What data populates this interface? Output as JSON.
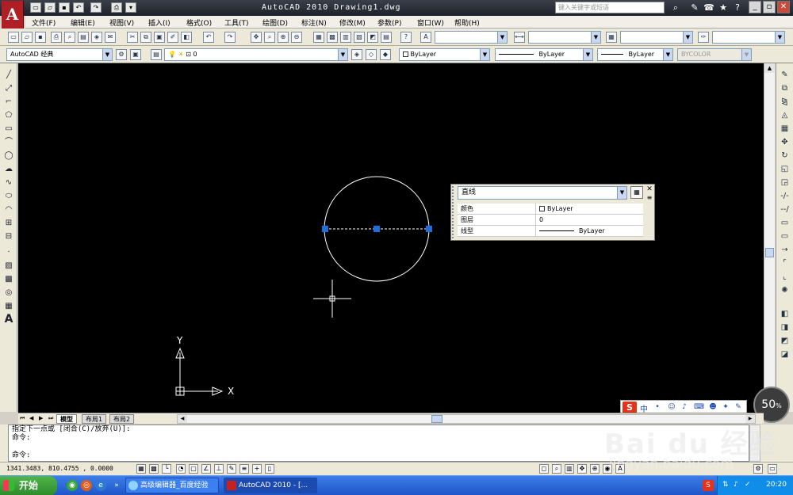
{
  "window": {
    "title": "AutoCAD 2010  Drawing1.dwg",
    "search_placeholder": "键入关键字或短语",
    "logo_letter": "A"
  },
  "menu": [
    {
      "label": "文件(F)"
    },
    {
      "label": "编辑(E)"
    },
    {
      "label": "视图(V)"
    },
    {
      "label": "插入(I)"
    },
    {
      "label": "格式(O)"
    },
    {
      "label": "工具(T)"
    },
    {
      "label": "绘图(D)"
    },
    {
      "label": "标注(N)"
    },
    {
      "label": "修改(M)"
    },
    {
      "label": "参数(P)"
    },
    {
      "label": "窗口(W)"
    },
    {
      "label": "帮助(H)"
    }
  ],
  "toolbar2": {
    "workspace": "AutoCAD 经典",
    "layer": "0",
    "color": "ByLayer",
    "linetype": "ByLayer",
    "lineweight": "ByLayer",
    "plotstyle": "BYCOLOR"
  },
  "properties_panel": {
    "object_type": "直线",
    "rows": [
      {
        "key": "颜色",
        "value": "ByLayer"
      },
      {
        "key": "图层",
        "value": "0"
      },
      {
        "key": "线型",
        "value": "ByLayer"
      }
    ]
  },
  "ucs": {
    "x_label": "X",
    "y_label": "Y"
  },
  "tabs": [
    {
      "label": "模型",
      "active": true
    },
    {
      "label": "布局1",
      "active": false
    },
    {
      "label": "布局2",
      "active": false
    }
  ],
  "command": {
    "lines": [
      "指定下一点或 [闭合(C)/放弃(U)]:",
      "命令:",
      "",
      "命令:"
    ]
  },
  "status": {
    "coordinates": "1341.3483,  810.4755 , 0.0000"
  },
  "zoom": {
    "value": "50",
    "unit": "%"
  },
  "ime": {
    "label": "中"
  },
  "taskbar": {
    "start_label": "开始",
    "tasks": [
      {
        "label": "高级编辑器_百度经验"
      },
      {
        "label": "AutoCAD 2010 - [..."
      }
    ],
    "clock": "20:20"
  },
  "watermark": {
    "text": "Bai du 经验",
    "url": "jingyan.baidu.com"
  },
  "colors": {
    "canvas_bg": "#000000",
    "grip": "#1e6fd9",
    "geometry": "#ffffff"
  }
}
